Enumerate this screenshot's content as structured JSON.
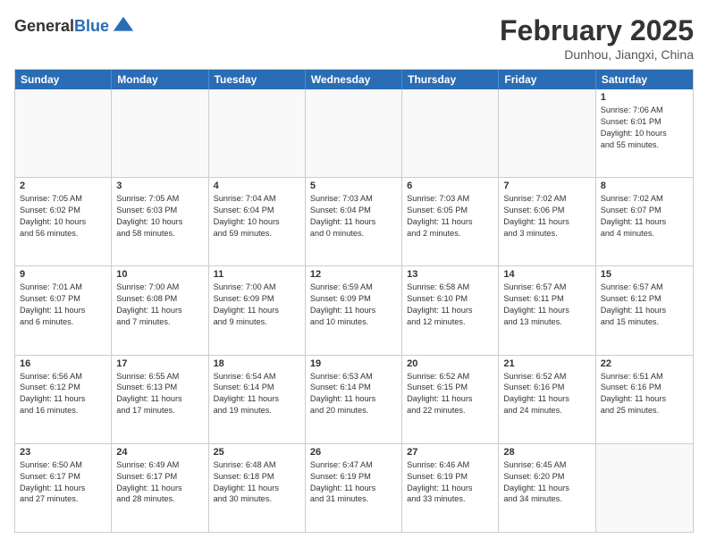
{
  "header": {
    "logo_line1": "General",
    "logo_line2": "Blue",
    "month": "February 2025",
    "location": "Dunhou, Jiangxi, China"
  },
  "weekdays": [
    "Sunday",
    "Monday",
    "Tuesday",
    "Wednesday",
    "Thursday",
    "Friday",
    "Saturday"
  ],
  "rows": [
    [
      {
        "day": "",
        "info": ""
      },
      {
        "day": "",
        "info": ""
      },
      {
        "day": "",
        "info": ""
      },
      {
        "day": "",
        "info": ""
      },
      {
        "day": "",
        "info": ""
      },
      {
        "day": "",
        "info": ""
      },
      {
        "day": "1",
        "info": "Sunrise: 7:06 AM\nSunset: 6:01 PM\nDaylight: 10 hours\nand 55 minutes."
      }
    ],
    [
      {
        "day": "2",
        "info": "Sunrise: 7:05 AM\nSunset: 6:02 PM\nDaylight: 10 hours\nand 56 minutes."
      },
      {
        "day": "3",
        "info": "Sunrise: 7:05 AM\nSunset: 6:03 PM\nDaylight: 10 hours\nand 58 minutes."
      },
      {
        "day": "4",
        "info": "Sunrise: 7:04 AM\nSunset: 6:04 PM\nDaylight: 10 hours\nand 59 minutes."
      },
      {
        "day": "5",
        "info": "Sunrise: 7:03 AM\nSunset: 6:04 PM\nDaylight: 11 hours\nand 0 minutes."
      },
      {
        "day": "6",
        "info": "Sunrise: 7:03 AM\nSunset: 6:05 PM\nDaylight: 11 hours\nand 2 minutes."
      },
      {
        "day": "7",
        "info": "Sunrise: 7:02 AM\nSunset: 6:06 PM\nDaylight: 11 hours\nand 3 minutes."
      },
      {
        "day": "8",
        "info": "Sunrise: 7:02 AM\nSunset: 6:07 PM\nDaylight: 11 hours\nand 4 minutes."
      }
    ],
    [
      {
        "day": "9",
        "info": "Sunrise: 7:01 AM\nSunset: 6:07 PM\nDaylight: 11 hours\nand 6 minutes."
      },
      {
        "day": "10",
        "info": "Sunrise: 7:00 AM\nSunset: 6:08 PM\nDaylight: 11 hours\nand 7 minutes."
      },
      {
        "day": "11",
        "info": "Sunrise: 7:00 AM\nSunset: 6:09 PM\nDaylight: 11 hours\nand 9 minutes."
      },
      {
        "day": "12",
        "info": "Sunrise: 6:59 AM\nSunset: 6:09 PM\nDaylight: 11 hours\nand 10 minutes."
      },
      {
        "day": "13",
        "info": "Sunrise: 6:58 AM\nSunset: 6:10 PM\nDaylight: 11 hours\nand 12 minutes."
      },
      {
        "day": "14",
        "info": "Sunrise: 6:57 AM\nSunset: 6:11 PM\nDaylight: 11 hours\nand 13 minutes."
      },
      {
        "day": "15",
        "info": "Sunrise: 6:57 AM\nSunset: 6:12 PM\nDaylight: 11 hours\nand 15 minutes."
      }
    ],
    [
      {
        "day": "16",
        "info": "Sunrise: 6:56 AM\nSunset: 6:12 PM\nDaylight: 11 hours\nand 16 minutes."
      },
      {
        "day": "17",
        "info": "Sunrise: 6:55 AM\nSunset: 6:13 PM\nDaylight: 11 hours\nand 17 minutes."
      },
      {
        "day": "18",
        "info": "Sunrise: 6:54 AM\nSunset: 6:14 PM\nDaylight: 11 hours\nand 19 minutes."
      },
      {
        "day": "19",
        "info": "Sunrise: 6:53 AM\nSunset: 6:14 PM\nDaylight: 11 hours\nand 20 minutes."
      },
      {
        "day": "20",
        "info": "Sunrise: 6:52 AM\nSunset: 6:15 PM\nDaylight: 11 hours\nand 22 minutes."
      },
      {
        "day": "21",
        "info": "Sunrise: 6:52 AM\nSunset: 6:16 PM\nDaylight: 11 hours\nand 24 minutes."
      },
      {
        "day": "22",
        "info": "Sunrise: 6:51 AM\nSunset: 6:16 PM\nDaylight: 11 hours\nand 25 minutes."
      }
    ],
    [
      {
        "day": "23",
        "info": "Sunrise: 6:50 AM\nSunset: 6:17 PM\nDaylight: 11 hours\nand 27 minutes."
      },
      {
        "day": "24",
        "info": "Sunrise: 6:49 AM\nSunset: 6:17 PM\nDaylight: 11 hours\nand 28 minutes."
      },
      {
        "day": "25",
        "info": "Sunrise: 6:48 AM\nSunset: 6:18 PM\nDaylight: 11 hours\nand 30 minutes."
      },
      {
        "day": "26",
        "info": "Sunrise: 6:47 AM\nSunset: 6:19 PM\nDaylight: 11 hours\nand 31 minutes."
      },
      {
        "day": "27",
        "info": "Sunrise: 6:46 AM\nSunset: 6:19 PM\nDaylight: 11 hours\nand 33 minutes."
      },
      {
        "day": "28",
        "info": "Sunrise: 6:45 AM\nSunset: 6:20 PM\nDaylight: 11 hours\nand 34 minutes."
      },
      {
        "day": "",
        "info": ""
      }
    ]
  ]
}
